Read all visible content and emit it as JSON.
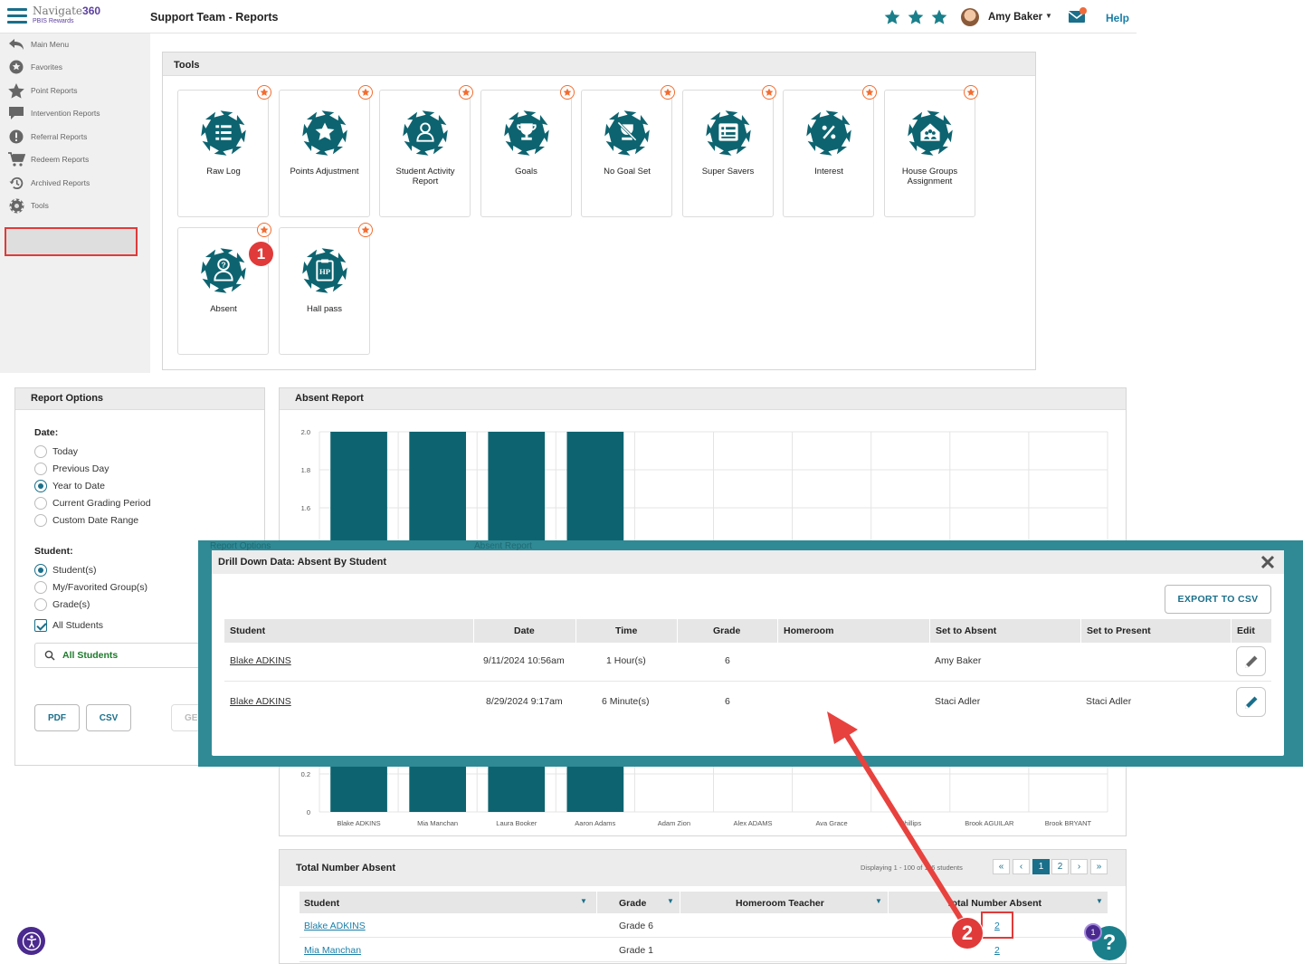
{
  "brand": {
    "name_plain": "Navigate",
    "name_bold": "360",
    "sub": "PBIS Rewards"
  },
  "header": {
    "title": "Support Team - Reports",
    "user_name": "Amy Baker",
    "help": "Help",
    "star_count": 3
  },
  "sidebar": {
    "items": [
      {
        "label": "Main Menu",
        "icon": "back-arrow-icon"
      },
      {
        "label": "Favorites",
        "icon": "star-circle-icon"
      },
      {
        "label": "Point Reports",
        "icon": "star-icon"
      },
      {
        "label": "Intervention Reports",
        "icon": "chat-bubble-icon"
      },
      {
        "label": "Referral Reports",
        "icon": "exclamation-icon"
      },
      {
        "label": "Redeem Reports",
        "icon": "cart-icon"
      },
      {
        "label": "Archived Reports",
        "icon": "history-icon"
      },
      {
        "label": "Tools",
        "icon": "gear-icon",
        "selected": true
      }
    ]
  },
  "tools": {
    "title": "Tools",
    "cards": [
      {
        "label": "Raw Log",
        "icon": "list-icon"
      },
      {
        "label": "Points Adjustment",
        "icon": "star-icon"
      },
      {
        "label": "Student Activity Report",
        "icon": "person-icon"
      },
      {
        "label": "Goals",
        "icon": "trophy-icon"
      },
      {
        "label": "No Goal Set",
        "icon": "no-trophy-icon"
      },
      {
        "label": "Super Savers",
        "icon": "list-card-icon"
      },
      {
        "label": "Interest",
        "icon": "percent-icon"
      },
      {
        "label": "House Groups Assignment",
        "icon": "house-icon"
      },
      {
        "label": "Absent",
        "icon": "absent-person-icon"
      },
      {
        "label": "Hall pass",
        "icon": "hall-pass-icon"
      }
    ]
  },
  "callouts": {
    "one": "1",
    "two": "2"
  },
  "report_options": {
    "title": "Report Options",
    "date_label": "Date:",
    "date_options": [
      "Today",
      "Previous Day",
      "Year to Date",
      "Current Grading Period",
      "Custom Date Range"
    ],
    "date_selected": "Year to Date",
    "student_label": "Student:",
    "student_options": [
      "Student(s)",
      "My/Favorited Group(s)",
      "Grade(s)"
    ],
    "student_selected": "Student(s)",
    "all_students_check": "All Students",
    "all_students_field": "All Students",
    "pdf": "PDF",
    "csv": "CSV",
    "generate_partial": "GE"
  },
  "absent_report": {
    "title": "Absent Report"
  },
  "chart_data": {
    "type": "bar",
    "categories": [
      "Blake ADKINS",
      "Mia Manchan",
      "Laura Booker",
      "Aaron Adams",
      "Adam Zion",
      "Alex ADAMS",
      "Ava Grace",
      "Phillips",
      "Brook AGUILAR",
      "Brook BRYANT"
    ],
    "values": [
      2,
      2,
      2,
      2,
      null,
      null,
      null,
      null,
      null,
      null
    ],
    "ylim": [
      0,
      2
    ],
    "yticks_visible": [
      "2.0",
      "1.8",
      "1.6",
      "0.2",
      "0"
    ],
    "grid": true,
    "color": "#0d6470"
  },
  "modal": {
    "ghost_left": "Report Options",
    "ghost_right": "Absent Report",
    "title": "Drill Down Data: Absent By Student",
    "export": "EXPORT TO CSV",
    "columns": [
      "Student",
      "Date",
      "Time",
      "Grade",
      "Homeroom",
      "Set to Absent",
      "Set to Present",
      "Edit"
    ],
    "rows": [
      {
        "student": "Blake ADKINS",
        "date": "9/11/2024 10:56am",
        "time": "1 Hour(s)",
        "grade": "6",
        "homeroom": "",
        "set_absent": "Amy Baker",
        "set_present": ""
      },
      {
        "student": "Blake ADKINS",
        "date": "8/29/2024 9:17am",
        "time": "6 Minute(s)",
        "grade": "6",
        "homeroom": "",
        "set_absent": "Staci Adler",
        "set_present": "Staci Adler"
      }
    ]
  },
  "total_absent": {
    "title": "Total Number Absent",
    "display_text": "Displaying 1 - 100 of 116 students",
    "pages": [
      "1",
      "2"
    ],
    "current_page": "1",
    "columns": [
      "Student",
      "Grade",
      "Homeroom Teacher",
      "Total Number Absent"
    ],
    "rows": [
      {
        "student": "Blake ADKINS",
        "grade": "Grade 6",
        "teacher": "",
        "total": "2"
      },
      {
        "student": "Mia Manchan",
        "grade": "Grade 1",
        "teacher": "",
        "total": "2"
      }
    ]
  },
  "help_fab": {
    "label": "?",
    "badge": "1"
  },
  "colors": {
    "teal": "#1a6f8a",
    "bar": "#0d6470",
    "callout_red": "#e03a3a",
    "fav_orange": "#f36c2f",
    "overlay": "#2f8a95"
  }
}
